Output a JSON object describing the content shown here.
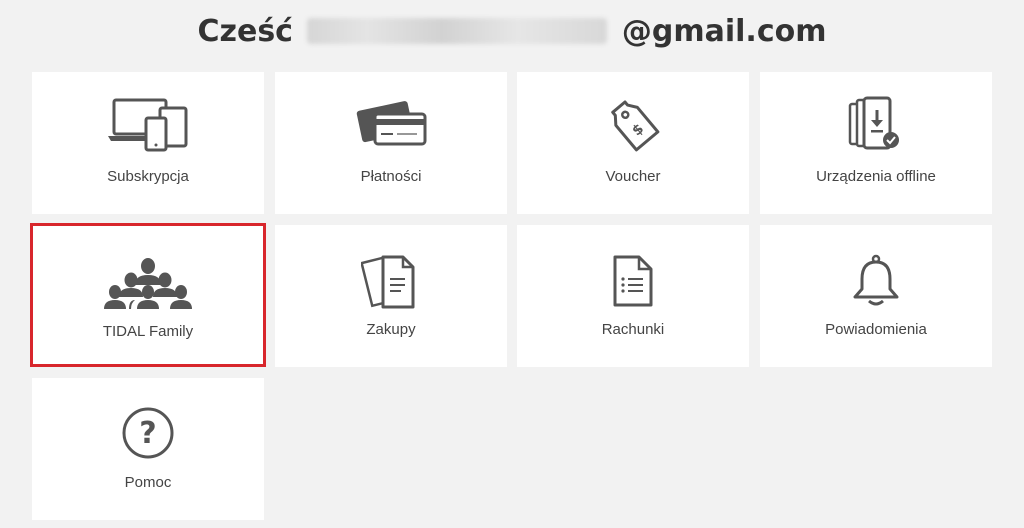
{
  "header": {
    "greeting_prefix": "Cześć",
    "greeting_suffix": "@gmail.com"
  },
  "tiles": [
    {
      "label": "Subskrypcja",
      "icon": "devices-icon"
    },
    {
      "label": "Płatności",
      "icon": "credit-card-icon"
    },
    {
      "label": "Voucher",
      "icon": "price-tag-icon"
    },
    {
      "label": "Urządzenia offline",
      "icon": "offline-devices-icon"
    },
    {
      "label": "TIDAL Family",
      "icon": "family-group-icon",
      "selected": true,
      "highlight_color": "#d8262c"
    },
    {
      "label": "Zakupy",
      "icon": "documents-icon"
    },
    {
      "label": "Rachunki",
      "icon": "invoice-icon"
    },
    {
      "label": "Powiadomienia",
      "icon": "bell-icon"
    },
    {
      "label": "Pomoc",
      "icon": "help-icon"
    }
  ],
  "colors": {
    "background": "#f2f2f2",
    "tile": "#ffffff",
    "icon": "#555555",
    "text": "#444444"
  }
}
